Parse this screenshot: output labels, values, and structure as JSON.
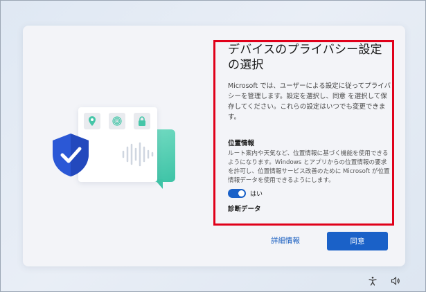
{
  "dialog": {
    "title": "デバイスのプライバシー設定の選択",
    "description": "Microsoft では、ユーザーによる設定に従ってプライバシーを管理します。設定を選択し、同意 を選択して保存してください。これらの設定はいつでも変更できます。",
    "sections": [
      {
        "heading": "位置情報",
        "body": "ルート案内や天気など、位置情報に基づく機能を使用できるようになります。Windows とアプリからの位置情報の要求を許可し、位置情報サービス改善のために Microsoft が位置情報データを使用できるようにします。",
        "toggle_label": "はい",
        "toggle_on": true
      },
      {
        "heading": "診断データ"
      }
    ]
  },
  "buttons": {
    "learn_more": "詳細情報",
    "accept": "同意"
  },
  "colors": {
    "accent": "#1a61c8",
    "highlight": "#e0001a",
    "illustration_green": "#3dc3a6",
    "shield_blue": "#2b58d6"
  },
  "system_tray": {
    "icons": [
      "accessibility-icon",
      "volume-icon"
    ]
  }
}
